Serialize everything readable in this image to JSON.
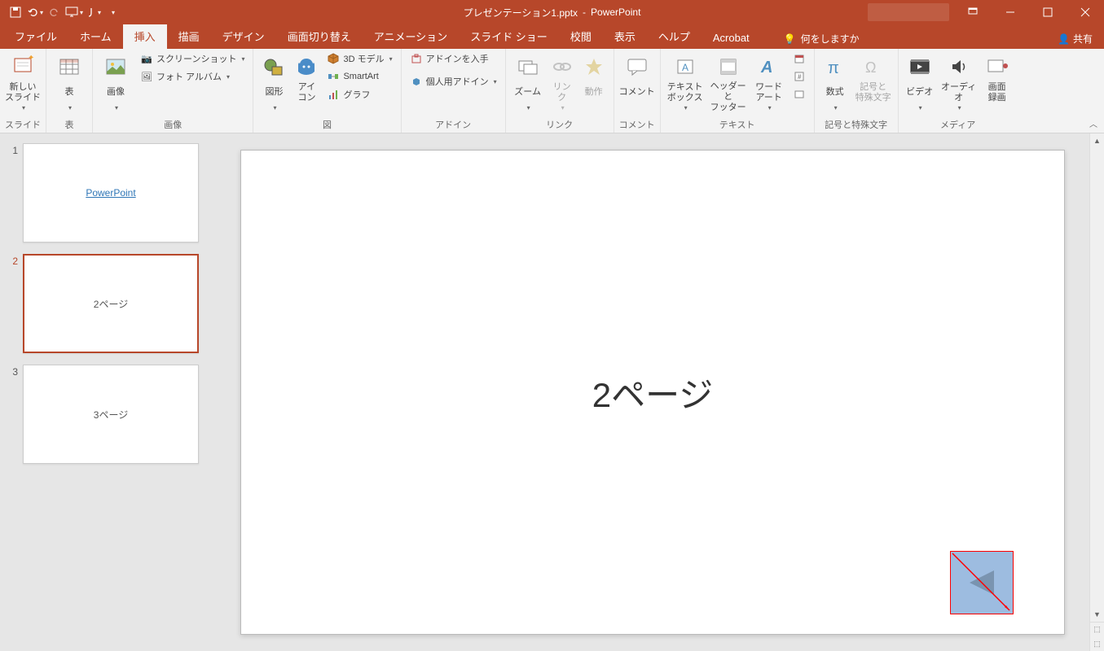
{
  "titlebar": {
    "filename": "プレゼンテーション1.pptx",
    "app": "PowerPoint",
    "sep": " - "
  },
  "qat": {
    "save": "💾",
    "undo": "↶",
    "redo": "↷",
    "start": "▦",
    "touch": "👆"
  },
  "tabs": {
    "file": "ファイル",
    "home": "ホーム",
    "insert": "挿入",
    "draw": "描画",
    "design": "デザイン",
    "transitions": "画面切り替え",
    "animations": "アニメーション",
    "slideshow": "スライド ショー",
    "review": "校閲",
    "view": "表示",
    "help": "ヘルプ",
    "acrobat": "Acrobat"
  },
  "tellme": "何をしますか",
  "share": "共有",
  "ribbon": {
    "slides": {
      "new_slide": "新しい\nスライド",
      "label": "スライド"
    },
    "tables": {
      "table": "表",
      "label": "表"
    },
    "images": {
      "pictures": "画像",
      "screenshot": "スクリーンショット",
      "album": "フォト アルバム",
      "label": "画像"
    },
    "illust": {
      "shapes": "図形",
      "icons": "アイ\nコン",
      "model3d": "3D モデル",
      "smartart": "SmartArt",
      "chart": "グラフ",
      "label": "図"
    },
    "addins": {
      "get": "アドインを入手",
      "my": "個人用アドイン",
      "label": "アドイン"
    },
    "links": {
      "zoom": "ズーム",
      "link": "リン\nク",
      "action": "動作",
      "label": "リンク"
    },
    "comments": {
      "comment": "コメント",
      "label": "コメント"
    },
    "text": {
      "textbox": "テキスト\nボックス",
      "header": "ヘッダーと\nフッター",
      "wordart": "ワード\nアート",
      "label": "テキスト"
    },
    "symbols": {
      "equation": "数式",
      "symbol": "記号と\n特殊文字",
      "label": "記号と特殊文字"
    },
    "media": {
      "video": "ビデオ",
      "audio": "オーディオ",
      "record": "画面\n録画",
      "label": "メディア"
    }
  },
  "thumbs": [
    {
      "num": "1",
      "content": "PowerPoint",
      "link": true
    },
    {
      "num": "2",
      "content": "2ページ",
      "active": true
    },
    {
      "num": "3",
      "content": "3ページ"
    }
  ],
  "slide": {
    "title": "2ページ"
  }
}
